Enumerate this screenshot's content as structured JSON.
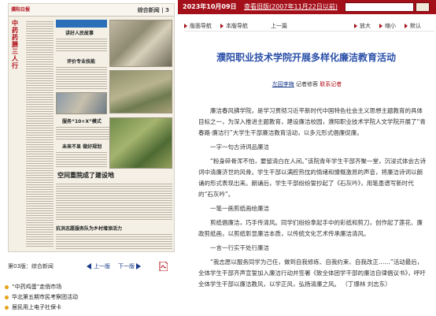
{
  "paper_thumb": {
    "masthead": "濮阳日报",
    "page_name": "综合新闻 | 3",
    "vertical_title": "中药药膳三人行",
    "headlines": [
      "讲好人民故事",
      "评价专业技能",
      "服务“10+X”模式",
      "未来不显 做好规划",
      "空间重院成了建设地",
      "抗洪志愿服务队为乡村增添活力"
    ],
    "big_headline": "空间重院成了建设地"
  },
  "page_nav": {
    "label": "第03版：综合新闻",
    "prev": "上一版",
    "next": "下一版"
  },
  "related": [
    "“中药鸡蛋”走俏市场",
    "华北第五期市民考察团活动",
    "居民用上电子社保卡"
  ],
  "topbar": {
    "date": "2023年10月09日",
    "history_link": "查看旧版(2007年11月22日以前)"
  },
  "navbar": {
    "items": [
      "版面导航",
      "本版导航",
      "上一篇"
    ],
    "zoom": [
      "放大",
      "缩小",
      "默认"
    ]
  },
  "article": {
    "title": "濮阳职业技术学院开展多样化廉洁教育活动",
    "byline_prefix": "",
    "author_link": "左园李梅",
    "byline_mid": "记者修蓉",
    "byline_red": "联系记者",
    "paragraphs": [
      "廉洁春风拂学院，是学习贯彻习近平新时代中国特色社会主义思想主题教育的具体目标之一，为深入推进主题教育，建设廉洁校园，濮阳职业技术学院人文学院开展了“青春路·廉洁行”大学生干部廉洁教育活动，以多元形式倡廉促廉。",
      "一字一句古诗词品廉洁",
      "“粉身碎骨浑不怕，要留清白在人间。”该院青年学生干部齐聚一堂，沉浸式体会古诗词中清廉济世的风骨。学生干部以满腔热忱的情绪和慷慨激昂的声音，将廉洁诗词以朗诵的形式表现出来。朗诵后，学生干部纷纷誓抄起了《石灰吟》，用笔墨谱写新时代的“石灰吟”。",
      "一笔一画剪纸画绘廉洁",
      "剪纸倡廉洁，巧手传清风。同学们纷纷拿起手中的彩纸和剪刀，创作起了莲花、廉政剪纸画，以剪纸彰显廉洁本质，以传统文化艺术传承廉洁清风。",
      "一言一行实干处行廉洁",
      "“我志愿以服务同学为己任，做到自我修练、自我约束、自我改正……”活动最后，全体学生干部齐声宣誓加入廉洁行动并签署《致全体团学干部的廉洁自律倡议书》，呼吁全体学生干部以廉洁教风，以学正风，弘扬清廉之风。 （丁爆林 刘志东）"
    ]
  },
  "colors": {
    "topbar_bg": "#a4101a",
    "title_blue": "#2a4fa8",
    "link_blue": "#1a3a8a",
    "accent_orange": "#e9a21b"
  }
}
